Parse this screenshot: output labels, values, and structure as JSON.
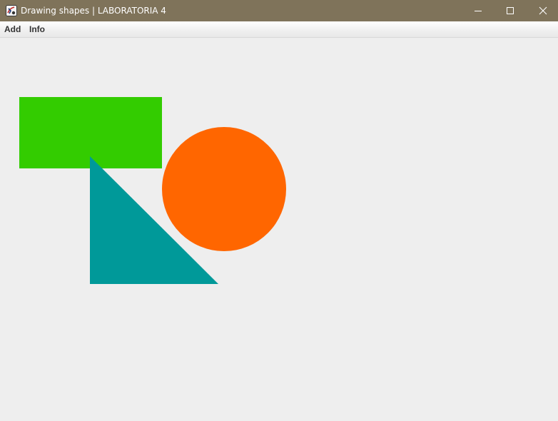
{
  "window": {
    "title": "Drawing shapes | LABORATORIA 4",
    "icon": "java-app-icon",
    "controls": {
      "minimize": "minimize-icon",
      "maximize": "maximize-icon",
      "close": "close-icon"
    }
  },
  "menu": {
    "items": [
      {
        "label": "Add"
      },
      {
        "label": "Info"
      }
    ]
  },
  "canvas": {
    "shapes": [
      {
        "type": "rectangle",
        "color": "#33cc00"
      },
      {
        "type": "circle",
        "color": "#ff6600"
      },
      {
        "type": "right-triangle",
        "color": "#009999"
      }
    ]
  }
}
